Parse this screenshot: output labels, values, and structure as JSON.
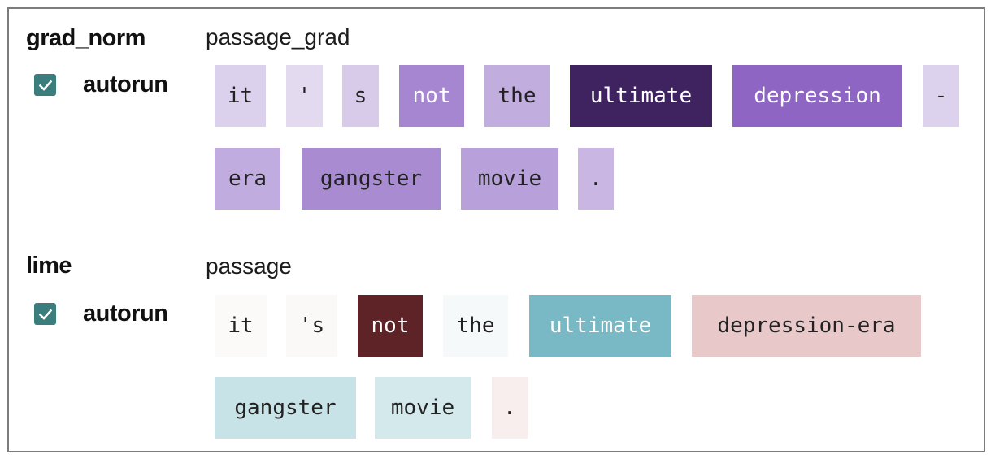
{
  "sections": [
    {
      "method": "grad_norm",
      "field": "passage_grad",
      "autorun": {
        "label": "autorun",
        "checked": true
      },
      "tokens": [
        {
          "text": "it",
          "bg": "#dcd1ec",
          "fg": "#222222"
        },
        {
          "text": "'",
          "bg": "#e3daf0",
          "fg": "#222222"
        },
        {
          "text": "s",
          "bg": "#d8cbea",
          "fg": "#222222"
        },
        {
          "text": "not",
          "bg": "#a686d0",
          "fg": "#ffffff"
        },
        {
          "text": "the",
          "bg": "#c2addf",
          "fg": "#222222"
        },
        {
          "text": "ultimate",
          "bg": "#3f2260",
          "fg": "#ffffff"
        },
        {
          "text": "depression",
          "bg": "#8e65c3",
          "fg": "#ffffff"
        },
        {
          "text": "-",
          "bg": "#ddd2ed",
          "fg": "#222222"
        },
        {
          "text": "era",
          "bg": "#c1acdf",
          "fg": "#222222"
        },
        {
          "text": "gangster",
          "bg": "#a98bd2",
          "fg": "#222222"
        },
        {
          "text": "movie",
          "bg": "#b8a0da",
          "fg": "#222222"
        },
        {
          "text": ".",
          "bg": "#c9b6e2",
          "fg": "#222222"
        }
      ]
    },
    {
      "method": "lime",
      "field": "passage",
      "autorun": {
        "label": "autorun",
        "checked": true
      },
      "tokens": [
        {
          "text": "it",
          "bg": "#fcf9f9",
          "fg": "#222222"
        },
        {
          "text": "'s",
          "bg": "#fbf8f8",
          "fg": "#222222"
        },
        {
          "text": "not",
          "bg": "#5e2326",
          "fg": "#ffffff"
        },
        {
          "text": "the",
          "bg": "#f6f9f9",
          "fg": "#222222"
        },
        {
          "text": "ultimate",
          "bg": "#79b9c5",
          "fg": "#ffffff"
        },
        {
          "text": "depression-era",
          "bg": "#e8c8c9",
          "fg": "#222222"
        },
        {
          "text": "gangster",
          "bg": "#c7e3e7",
          "fg": "#222222"
        },
        {
          "text": "movie",
          "bg": "#d3e9ec",
          "fg": "#222222"
        },
        {
          "text": ".",
          "bg": "#f8eeee",
          "fg": "#222222"
        }
      ]
    }
  ]
}
